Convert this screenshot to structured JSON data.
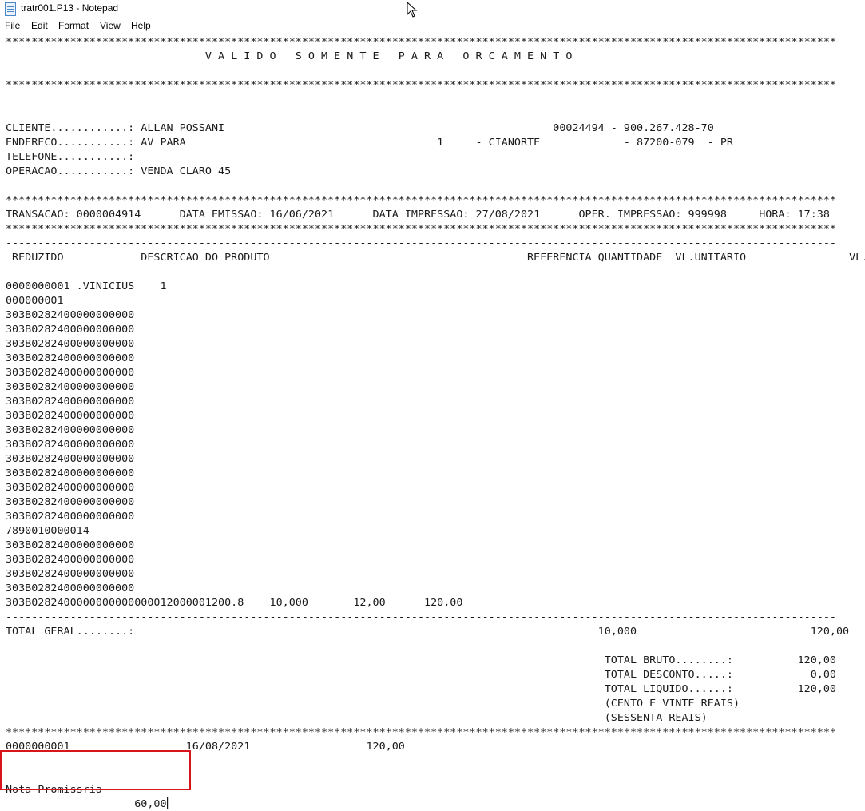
{
  "window": {
    "title": "tratr001.P13 - Notepad",
    "icon": "notepad-icon"
  },
  "menu": {
    "file": {
      "u": "F",
      "rest": "ile"
    },
    "edit": {
      "u": "E",
      "rest": "dit"
    },
    "format": {
      "u": "o",
      "pre": "F",
      "rest": "rmat"
    },
    "view": {
      "u": "V",
      "rest": "iew"
    },
    "help": {
      "u": "H",
      "rest": "elp"
    }
  },
  "document": {
    "lines": [
      "*********************************************************************************************************************************",
      "                               V A L I D O   S O M E N T E   P A R A   O R C A M E N T O",
      "",
      "*********************************************************************************************************************************",
      "",
      "",
      "CLIENTE............: ALLAN POSSANI                                                   00024494 - 900.267.428-70",
      "ENDERECO...........: AV PARA                                       1     - CIANORTE             - 87200-079  - PR",
      "TELEFONE...........:",
      "OPERACAO...........: VENDA CLARO 45",
      "",
      "*********************************************************************************************************************************",
      "TRANSACAO: 0000004914      DATA EMISSAO: 16/06/2021      DATA IMPRESSAO: 27/08/2021      OPER. IMPRESSAO: 999998     HORA: 17:38",
      "*********************************************************************************************************************************",
      "---------------------------------------------------------------------------------------------------------------------------------",
      " REDUZIDO            DESCRICAO DO PRODUTO                                        REFERENCIA QUANTIDADE  VL.UNITARIO                VL.TOTAL",
      "",
      "0000000001 .VINICIUS    1",
      "000000001",
      "303B0282400000000000",
      "303B0282400000000000",
      "303B0282400000000000",
      "303B0282400000000000",
      "303B0282400000000000",
      "303B0282400000000000",
      "303B0282400000000000",
      "303B0282400000000000",
      "303B0282400000000000",
      "303B0282400000000000",
      "303B0282400000000000",
      "303B0282400000000000",
      "303B0282400000000000",
      "303B0282400000000000",
      "303B0282400000000000",
      "7890010000014",
      "303B0282400000000000",
      "303B0282400000000000",
      "303B0282400000000000",
      "303B0282400000000000",
      "303B0282400000000000000012000001200.8    10,000       12,00      120,00",
      "---------------------------------------------------------------------------------------------------------------------------------",
      "TOTAL GERAL........:                                                                        10,000                           120,00",
      "---------------------------------------------------------------------------------------------------------------------------------",
      "                                                                                             TOTAL BRUTO........:          120,00",
      "                                                                                             TOTAL DESCONTO.....:            0,00",
      "                                                                                             TOTAL LIQUIDO......:          120,00",
      "                                                                                             (CENTO E VINTE REAIS)",
      "                                                                                             (SESSENTA REAIS)",
      "*********************************************************************************************************************************",
      "0000000001                  16/08/2021                  120,00",
      "",
      "",
      "Nota Promissria",
      "                    60,00"
    ]
  }
}
